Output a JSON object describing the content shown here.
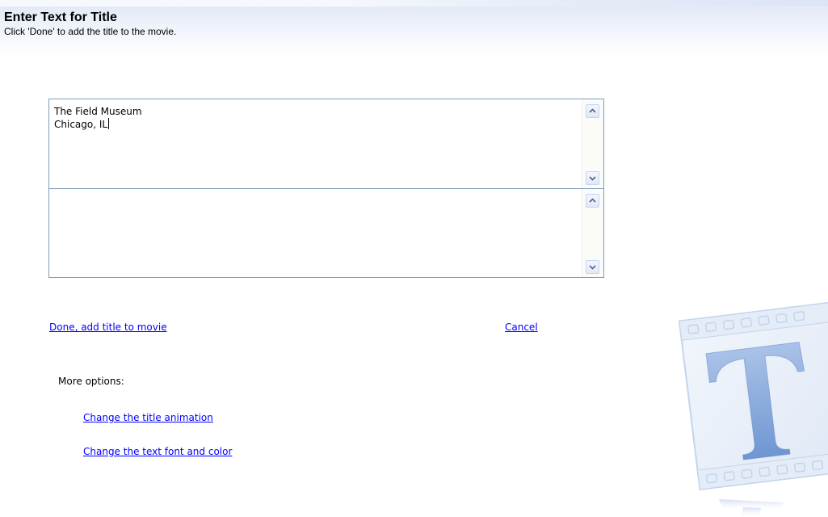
{
  "header": {
    "title": "Enter Text for Title",
    "subtitle": "Click 'Done' to add the title to the movie."
  },
  "editor": {
    "upper_pane_lines": [
      "The Field Museum",
      "Chicago, IL"
    ],
    "lower_pane_text": ""
  },
  "actions": {
    "done_label": "Done, add title to movie",
    "cancel_label": "Cancel"
  },
  "more_options": {
    "label": "More options:",
    "items": [
      {
        "label": "Change the title animation"
      },
      {
        "label": "Change the text font and color"
      }
    ]
  },
  "decoration": {
    "watermark_letter": "T"
  },
  "colors": {
    "link": "#0000ff",
    "editor_border": "#7f9db9",
    "header_gradient": "#dfe7f6",
    "watermark": "#8fb0e0"
  }
}
